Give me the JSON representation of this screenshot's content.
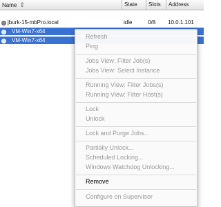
{
  "table": {
    "columns": [
      {
        "label": "Name"
      },
      {
        "label": "State"
      },
      {
        "label": "Slots"
      },
      {
        "label": "Address"
      }
    ],
    "rows": [
      {
        "name": "jburk-15-mbPro.local",
        "state": "idle",
        "slots": "0/8",
        "address": "10.0.1.101",
        "selected": false
      },
      {
        "name": "VM-Win7-x64",
        "state": "",
        "slots": "",
        "address": "",
        "selected": true
      },
      {
        "name": "VM-Win7-x64",
        "state": "",
        "slots": "",
        "address": "",
        "selected": true
      }
    ]
  },
  "context_menu": {
    "groups": [
      [
        {
          "label": "Refresh",
          "enabled": false
        },
        {
          "label": "Ping",
          "enabled": false
        }
      ],
      [
        {
          "label": "Jobs View: Filter Job(s)",
          "enabled": false
        },
        {
          "label": "Jobs View: Select Instance",
          "enabled": false
        }
      ],
      [
        {
          "label": "Running View: Filter Jobs(s)",
          "enabled": false
        },
        {
          "label": "Running View: Filter Host(s)",
          "enabled": false
        }
      ],
      [
        {
          "label": "Lock",
          "enabled": false
        },
        {
          "label": "Unlock",
          "enabled": false
        }
      ],
      [
        {
          "label": "Lock and Purge Jobs...",
          "enabled": false
        }
      ],
      [
        {
          "label": "Partially Unlock...",
          "enabled": false
        },
        {
          "label": "Scheduled Locking...",
          "enabled": false
        },
        {
          "label": "Windows Watchdog Unlocking...",
          "enabled": false
        }
      ],
      [
        {
          "label": "Remove",
          "enabled": true
        }
      ],
      [
        {
          "label": "Configure on Supervisor",
          "enabled": false
        }
      ]
    ]
  },
  "colors": {
    "selection": "#3a72d3",
    "menu_disabled_text": "#9a9a9a",
    "menu_enabled_text": "#000000"
  },
  "icons": {
    "sort": "sort-ascending-icon",
    "row_status": "status-dot-icon"
  }
}
